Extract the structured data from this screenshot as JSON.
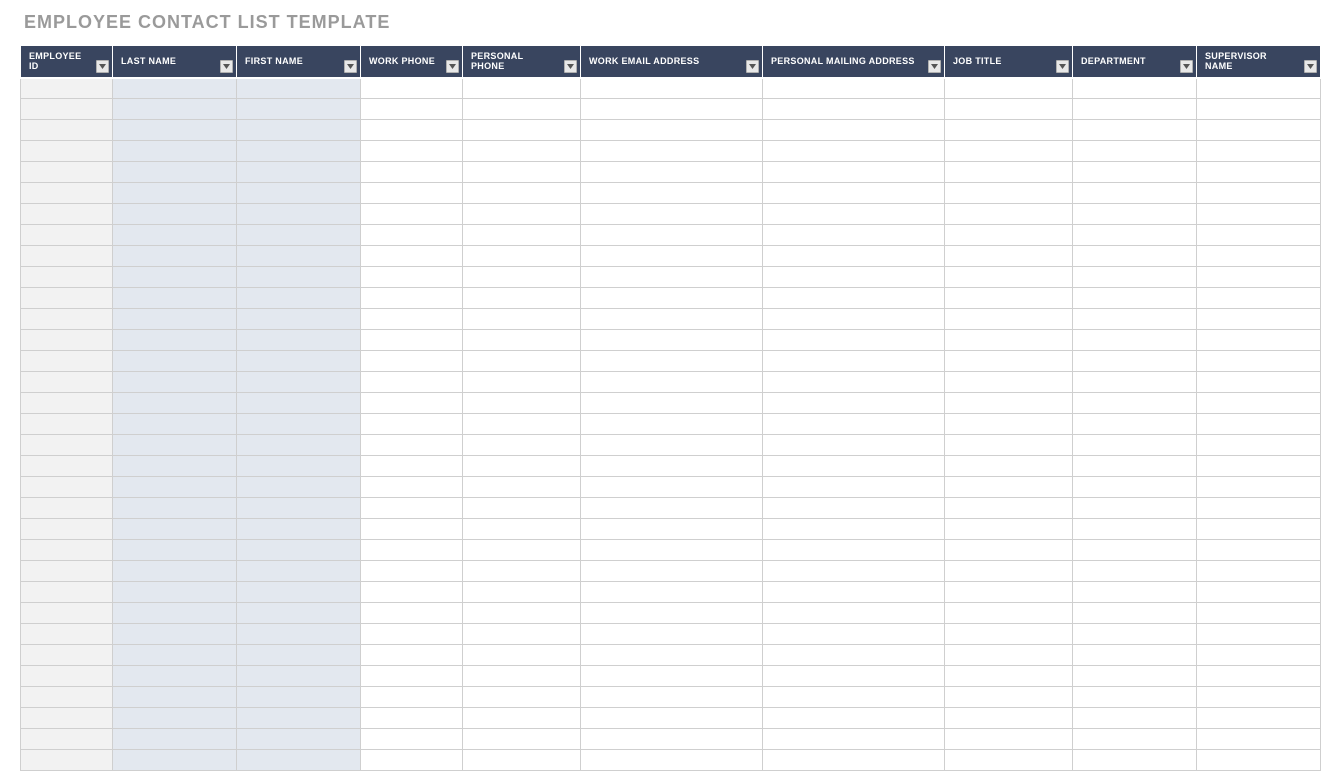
{
  "title": "EMPLOYEE CONTACT LIST TEMPLATE",
  "columns": [
    {
      "label": "EMPLOYEE ID",
      "shade": "a"
    },
    {
      "label": "LAST NAME",
      "shade": "b"
    },
    {
      "label": "FIRST NAME",
      "shade": "b"
    },
    {
      "label": "WORK PHONE",
      "shade": ""
    },
    {
      "label": "PERSONAL PHONE",
      "shade": ""
    },
    {
      "label": "WORK EMAIL ADDRESS",
      "shade": ""
    },
    {
      "label": "PERSONAL MAILING ADDRESS",
      "shade": ""
    },
    {
      "label": "JOB TITLE",
      "shade": ""
    },
    {
      "label": "DEPARTMENT",
      "shade": ""
    },
    {
      "label": "SUPERVISOR NAME",
      "shade": ""
    }
  ],
  "row_count": 33
}
